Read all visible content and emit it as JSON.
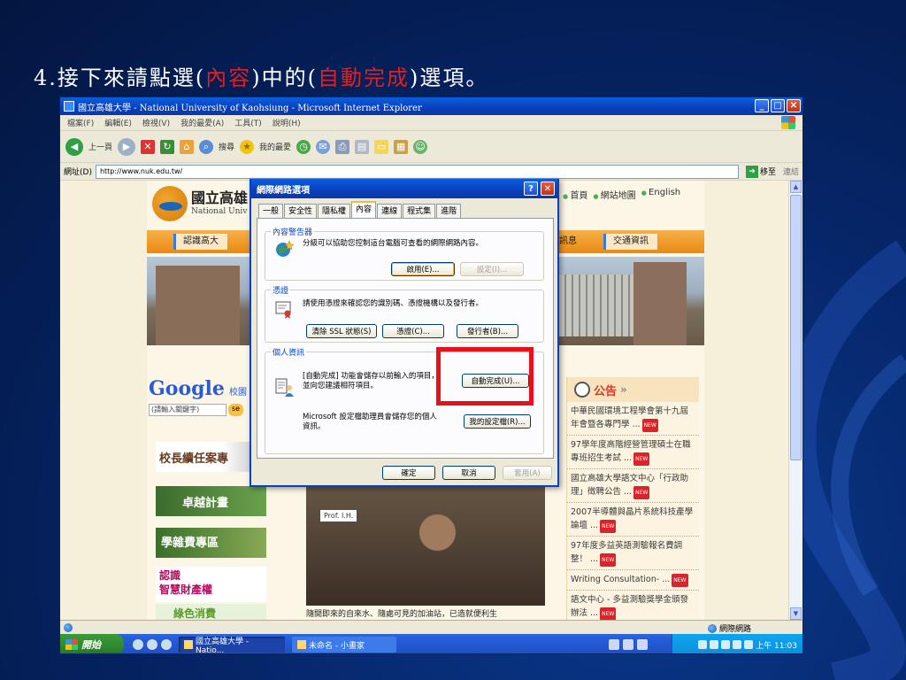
{
  "slide": {
    "title_prefix": "4.接下來請點選(",
    "title_hl1": "內容",
    "title_mid": ")中的(",
    "title_hl2": "自動完成",
    "title_suffix": ")選項。"
  },
  "browser": {
    "window_title": "國立高雄大學 - National University of Kaohsiung - Microsoft Internet Explorer",
    "menu": [
      "檔案(F)",
      "編輯(E)",
      "檢視(V)",
      "我的最愛(A)",
      "工具(T)",
      "說明(H)"
    ],
    "toolbar": {
      "back": "上一頁",
      "search": "搜尋",
      "favorites": "我的最愛"
    },
    "address_label": "網址(D)",
    "address_value": "http://www.nuk.edu.tw/",
    "go_label": "移至",
    "links_label": "連結",
    "status_zone": "網際網路"
  },
  "webpage": {
    "uni_name": "國立高雄",
    "uni_en": "National Univ",
    "top_links": [
      "首頁",
      "網站地圖",
      "English"
    ],
    "nav": [
      "認識高大",
      "生訊息",
      "交通資訊"
    ],
    "google": "Google",
    "google_suffix": "校園",
    "search_placeholder": "(請輸入關鍵字)",
    "search_btn": "se",
    "side_banners": [
      "校長續任案專",
      "卓越計畫",
      "學雜費專區",
      "認識\n智慧財產權",
      "綠色消費"
    ],
    "photo_label": "Prof. I.H.",
    "photo_caption": "隨開即來的自來水、隨處可見的加油站，已造就便利生",
    "announce_label": "公告",
    "announce_arrows": "»",
    "announcements": [
      "中華民國環境工程學會第十九屆年會暨各專門學 ...",
      "97學年度高階經營管理碩士在職專班招生考試 ...",
      "國立高雄大學語文中心「行政助理」徵聘公告 ...",
      "2007半導體與晶片系統科技產學論壇 ...",
      "97年度多益英語測驗報名費調整！ ...",
      "Writing Consultation- ...",
      "語文中心 - 多益測驗獎學金頒發辦法 ..."
    ],
    "new_tag": "NEW"
  },
  "dialog": {
    "title": "網際網路選項",
    "help": "?",
    "close": "✕",
    "tabs": [
      "一般",
      "安全性",
      "隱私權",
      "內容",
      "連線",
      "程式集",
      "進階"
    ],
    "content_advisor": {
      "legend": "內容警告器",
      "desc": "分級可以協助您控制這台電腦可查看的網際網路內容。",
      "enable_btn": "啟用(E)...",
      "settings_btn": "設定(I)..."
    },
    "certificates": {
      "legend": "憑證",
      "desc": "請使用憑證來確認您的識別碼、憑證機構以及發行者。",
      "clear_ssl_btn": "清除 SSL 狀態(S)",
      "certs_btn": "憑證(C)...",
      "publishers_btn": "發行者(B)..."
    },
    "personal": {
      "legend": "個人資訊",
      "autocomplete_desc": "[自動完成] 功能會儲存以前輸入的項目，並向您建議相符項目。",
      "autocomplete_btn": "自動完成(U)...",
      "profile_desc": "Microsoft 設定檔助理員會儲存您的個人資訊。",
      "profile_btn": "我的設定檔(R)..."
    },
    "ok_btn": "確定",
    "cancel_btn": "取消",
    "apply_btn": "套用(A)"
  },
  "taskbar": {
    "start": "開始",
    "tasks": [
      "國立高雄大學 - Natio...",
      "未命名 - 小畫家"
    ],
    "clock": "上午 11:03"
  }
}
